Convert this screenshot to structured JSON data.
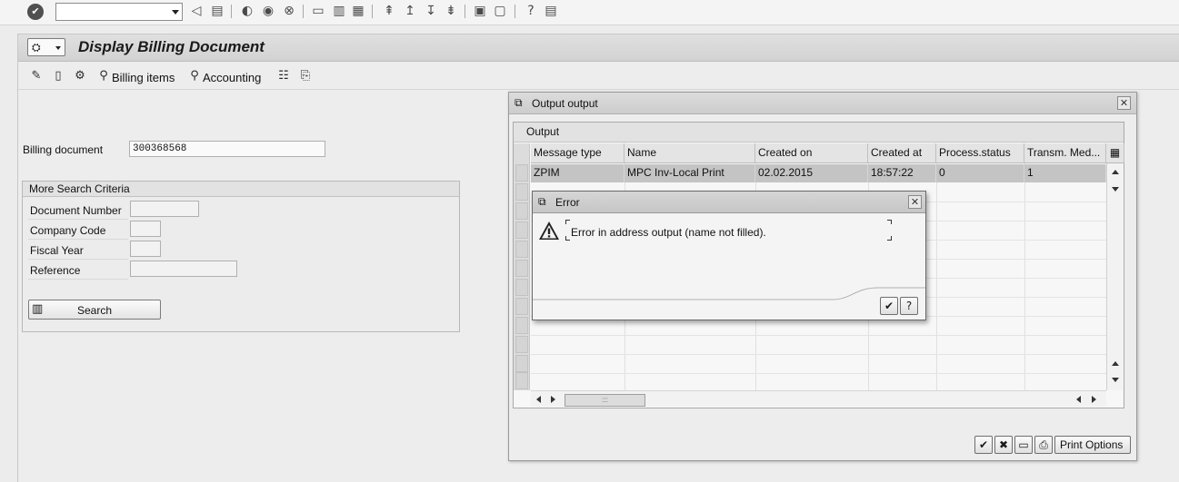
{
  "system_toolbar": {
    "command_field_value": "",
    "icons": [
      "enter-icon",
      "back-icon",
      "save-icon",
      "back-circle-icon",
      "exit-icon",
      "cancel-icon",
      "print-icon",
      "find-icon",
      "find-next-icon",
      "first-page-icon",
      "previous-page-icon",
      "next-page-icon",
      "last-page-icon",
      "create-session-icon",
      "shortcut-icon",
      "help-icon",
      "customize-layout-icon"
    ]
  },
  "window": {
    "title": "Display Billing Document",
    "menu_icon": "layout-menu-icon"
  },
  "app_toolbar": {
    "billing_items_label": "Billing items",
    "accounting_label": "Accounting"
  },
  "selection": {
    "billing_document_label": "Billing document",
    "billing_document_value": "300368568",
    "more_search_title": "More Search Criteria",
    "document_number_label": "Document Number",
    "company_code_label": "Company Code",
    "fiscal_year_label": "Fiscal Year",
    "reference_label": "Reference",
    "search_button_label": "Search"
  },
  "output_dialog": {
    "title": "Output output",
    "table_title": "Output",
    "columns": [
      "Message type",
      "Name",
      "Created on",
      "Created at",
      "Process.status",
      "Transm. Med..."
    ],
    "rows": [
      [
        "ZPIM",
        "MPC Inv-Local Print",
        "02.02.2015",
        "18:57:22",
        "0",
        "1"
      ]
    ],
    "scroll_thumb_text": ":::",
    "print_options_label": "Print Options"
  },
  "error_dialog": {
    "title": "Error",
    "message": "Error in address output (name not filled)."
  }
}
